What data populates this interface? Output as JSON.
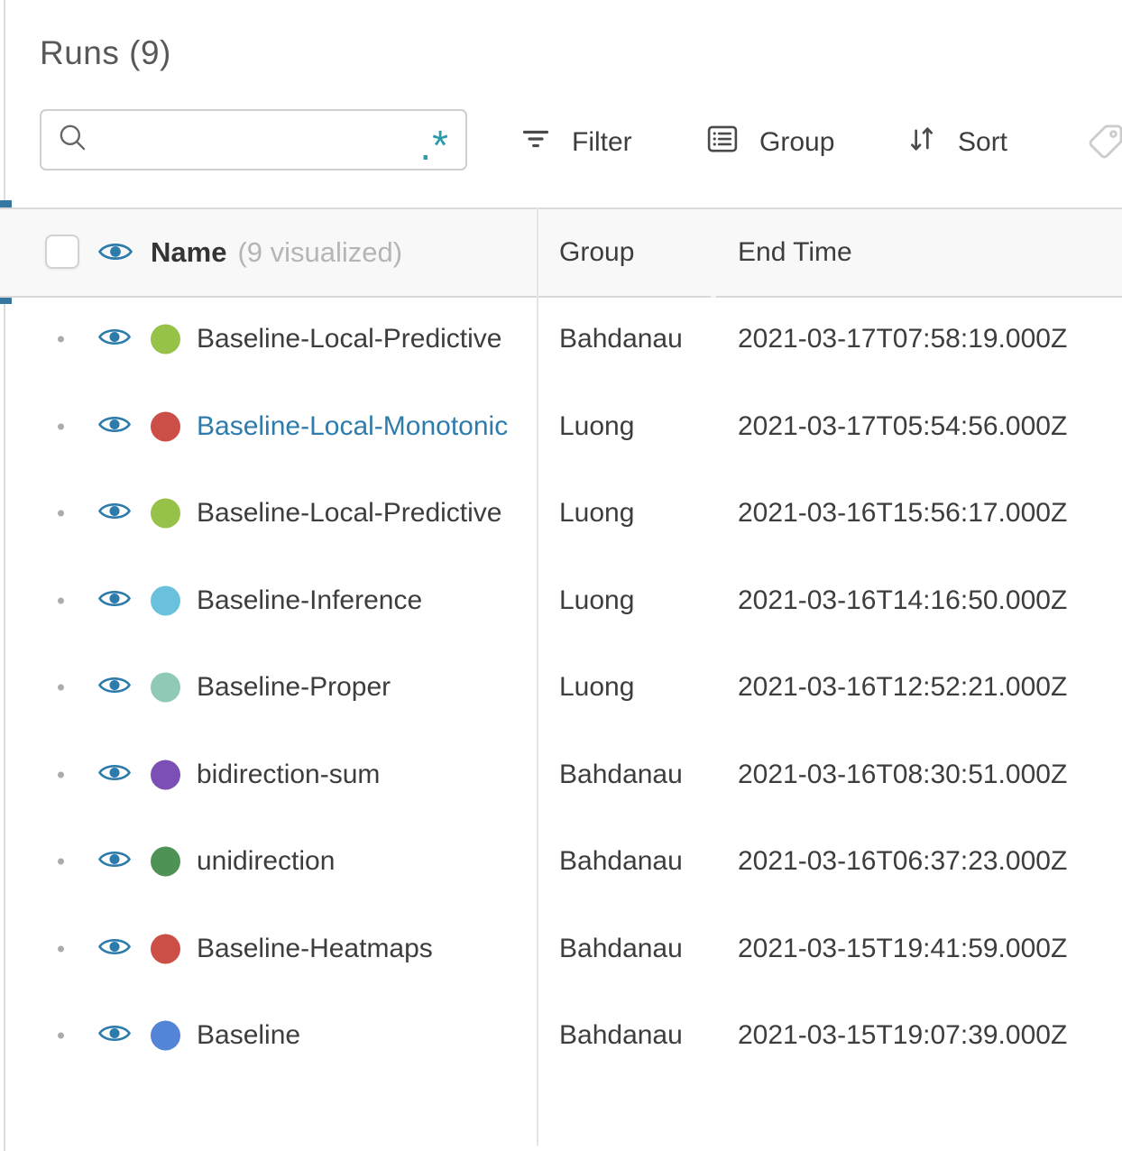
{
  "panel": {
    "title": "Runs (9)",
    "search": {
      "value": "",
      "placeholder": "",
      "regex_glyph": ".*"
    },
    "toolbar": {
      "buttons": [
        {
          "label": "Filter"
        },
        {
          "label": "Group"
        },
        {
          "label": "Sort"
        }
      ]
    },
    "colors": {
      "accent_bar": "#36789f",
      "eye_icon": "#2d7bab",
      "link": "#2d7cab",
      "regex_icon": "#2a9bab",
      "header_bg": "#f8f8f8"
    }
  },
  "table": {
    "header": {
      "name": "Name",
      "visualized": "(9 visualized)",
      "group": "Group",
      "end_time": "End Time"
    },
    "rows": [
      {
        "name": "Baseline-Local-Predictive",
        "color": "#97c249",
        "group": "Bahdanau",
        "end_time": "2021-03-17T07:58:19.000Z"
      },
      {
        "name": "Baseline-Local-Monotonic",
        "color": "#cb4f47",
        "name_color": "#2d7cab",
        "group": "Luong",
        "end_time": "2021-03-17T05:54:56.000Z"
      },
      {
        "name": "Baseline-Local-Predictive",
        "color": "#97c249",
        "group": "Luong",
        "end_time": "2021-03-16T15:56:17.000Z"
      },
      {
        "name": "Baseline-Inference",
        "color": "#69c1dd",
        "group": "Luong",
        "end_time": "2021-03-16T14:16:50.000Z"
      },
      {
        "name": "Baseline-Proper",
        "color": "#8ecab5",
        "group": "Luong",
        "end_time": "2021-03-16T12:52:21.000Z"
      },
      {
        "name": "bidirection-sum",
        "color": "#7b4fb5",
        "group": "Bahdanau",
        "end_time": "2021-03-16T08:30:51.000Z"
      },
      {
        "name": "unidirection",
        "color": "#4f9255",
        "group": "Bahdanau",
        "end_time": "2021-03-16T06:37:23.000Z"
      },
      {
        "name": "Baseline-Heatmaps",
        "color": "#cb4f47",
        "group": "Bahdanau",
        "end_time": "2021-03-15T19:41:59.000Z"
      },
      {
        "name": "Baseline",
        "color": "#5484d6",
        "group": "Bahdanau",
        "end_time": "2021-03-15T19:07:39.000Z"
      }
    ]
  }
}
